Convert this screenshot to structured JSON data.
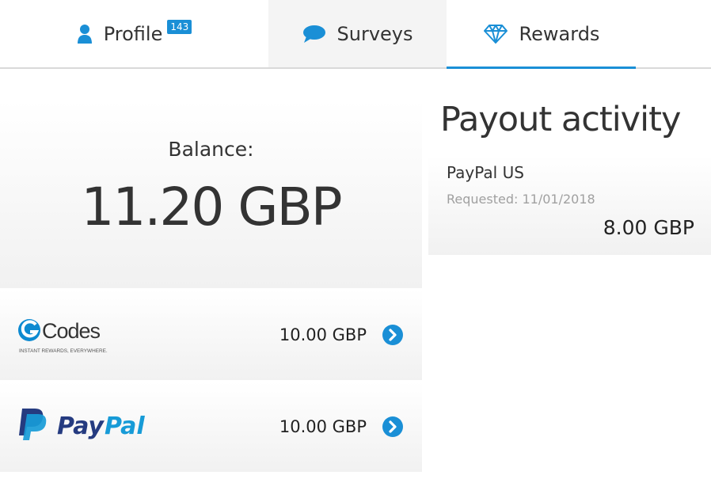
{
  "tabs": {
    "profile": {
      "label": "Profile",
      "badge": "143",
      "icon": "user-icon"
    },
    "surveys": {
      "label": "Surveys",
      "icon": "speech-bubble-icon"
    },
    "rewards": {
      "label": "Rewards",
      "icon": "diamond-icon",
      "active": true
    }
  },
  "balance": {
    "label": "Balance:",
    "amount": "11.20 GBP"
  },
  "rewards": [
    {
      "name": "GCodes",
      "tagline": "INSTANT REWARDS, EVERYWHERE.",
      "amount": "10.00 GBP",
      "icon": "chevron-right-circle-icon"
    },
    {
      "name": "PayPal",
      "amount": "10.00 GBP",
      "icon": "chevron-right-circle-icon"
    }
  ],
  "payout_activity": {
    "title": "Payout activity",
    "items": [
      {
        "method": "PayPal US",
        "requested": "Requested: 11/01/2018",
        "amount": "8.00 GBP"
      }
    ]
  },
  "colors": {
    "accent": "#1a8fd6",
    "paypal_dark": "#253b80",
    "paypal_light": "#179bd7",
    "gcodes_blue": "#0d8ad1"
  }
}
